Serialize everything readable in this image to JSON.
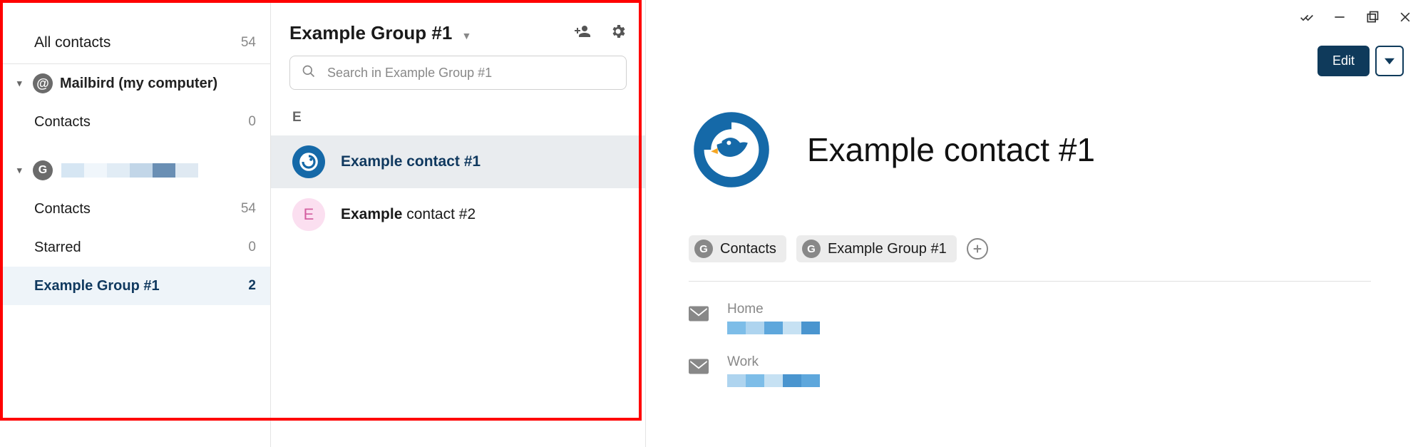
{
  "sidebar": {
    "all_label": "All contacts",
    "all_count": "54",
    "accounts": [
      {
        "name": "Mailbird (my computer)",
        "icon": "mailbird",
        "items": [
          {
            "label": "Contacts",
            "count": "0"
          }
        ]
      },
      {
        "name": "",
        "icon": "google",
        "redacted": true,
        "items": [
          {
            "label": "Contacts",
            "count": "54"
          },
          {
            "label": "Starred",
            "count": "0"
          },
          {
            "label": "Example Group #1",
            "count": "2",
            "active": true
          }
        ]
      }
    ]
  },
  "list": {
    "group_title": "Example Group #1",
    "search_placeholder": "Search in Example Group #1",
    "section_letter": "E",
    "items": [
      {
        "match": "Example contact",
        "rest": " #1",
        "avatar": "bird",
        "active": true
      },
      {
        "match": "Example",
        "rest": " contact #2",
        "avatar": "E"
      }
    ]
  },
  "detail": {
    "edit_label": "Edit",
    "name": "Example contact #1",
    "tags": [
      {
        "label": "Contacts"
      },
      {
        "label": "Example Group #1"
      }
    ],
    "fields": [
      {
        "label": "Home"
      },
      {
        "label": "Work"
      }
    ]
  }
}
